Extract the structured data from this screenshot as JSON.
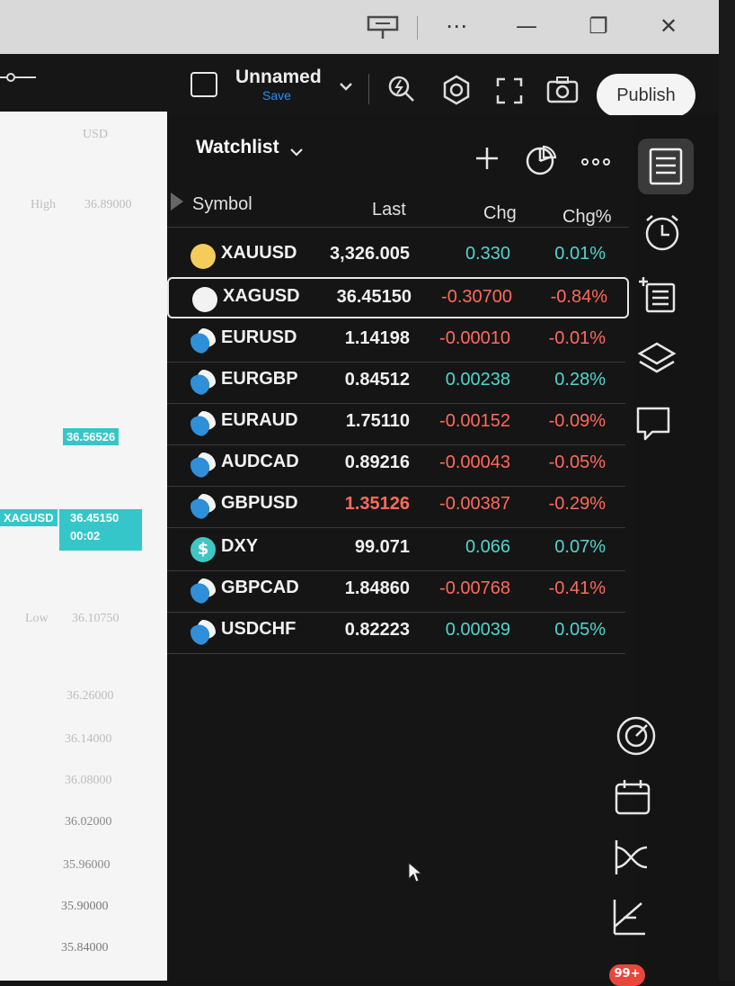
{
  "window": {
    "controls": [
      "⋯",
      "—",
      "❐",
      "✕"
    ]
  },
  "toolbar": {
    "layout_name": "Unnamed",
    "save_label": "Save",
    "publish_label": "Publish"
  },
  "chart_panel": {
    "currency": "USD",
    "high_label": "High",
    "high_value": "36.89000",
    "low_label": "Low",
    "low_value": "36.10750",
    "price_tag_top": "36.56526",
    "symbol_tag": "XAGUSD",
    "price_tag_current": "36.45150",
    "countdown": "00:02",
    "axis_ticks": [
      "36.26000",
      "36.14000",
      "36.08000",
      "36.02000",
      "35.96000",
      "35.90000",
      "35.84000"
    ]
  },
  "watchlist": {
    "title": "Watchlist",
    "columns": {
      "symbol": "Symbol",
      "last": "Last",
      "chg": "Chg",
      "chgp": "Chg%"
    },
    "colors": {
      "positive": "#4fd6cf",
      "negative": "#ff6a5c"
    },
    "rows": [
      {
        "symbol": "XAUUSD",
        "last": "3,326.005",
        "chg": "0.330",
        "chgp": "0.01%",
        "dir": "up",
        "icon": "gold-icon",
        "last_color": "#f0f0f0"
      },
      {
        "symbol": "XAGUSD",
        "last": "36.45150",
        "chg": "-0.30700",
        "chgp": "-0.84%",
        "dir": "down",
        "icon": "silver-icon",
        "last_color": "#f0f0f0"
      },
      {
        "symbol": "EURUSD",
        "last": "1.14198",
        "chg": "-0.00010",
        "chgp": "-0.01%",
        "dir": "down",
        "icon": "pair-flag-icon",
        "last_color": "#f0f0f0"
      },
      {
        "symbol": "EURGBP",
        "last": "0.84512",
        "chg": "0.00238",
        "chgp": "0.28%",
        "dir": "up",
        "icon": "pair-flag-icon",
        "last_color": "#f0f0f0"
      },
      {
        "symbol": "EURAUD",
        "last": "1.75110",
        "chg": "-0.00152",
        "chgp": "-0.09%",
        "dir": "down",
        "icon": "pair-flag-icon",
        "last_color": "#f0f0f0"
      },
      {
        "symbol": "AUDCAD",
        "last": "0.89216",
        "chg": "-0.00043",
        "chgp": "-0.05%",
        "dir": "down",
        "icon": "pair-flag-icon",
        "last_color": "#f0f0f0"
      },
      {
        "symbol": "GBPUSD",
        "last": "1.35126",
        "chg": "-0.00387",
        "chgp": "-0.29%",
        "dir": "down",
        "icon": "pair-flag-icon",
        "last_color": "#ff6a5c"
      },
      {
        "symbol": "DXY",
        "last": "99.071",
        "chg": "0.066",
        "chgp": "0.07%",
        "dir": "up",
        "icon": "dollar-icon",
        "last_color": "#f0f0f0"
      },
      {
        "symbol": "GBPCAD",
        "last": "1.84860",
        "chg": "-0.00768",
        "chgp": "-0.41%",
        "dir": "down",
        "icon": "pair-flag-icon",
        "last_color": "#f0f0f0"
      },
      {
        "symbol": "USDCHF",
        "last": "0.82223",
        "chg": "0.00039",
        "chgp": "0.05%",
        "dir": "up",
        "icon": "pair-flag-icon",
        "last_color": "#f0f0f0"
      }
    ]
  },
  "sidebar": {
    "badge": "99+"
  }
}
